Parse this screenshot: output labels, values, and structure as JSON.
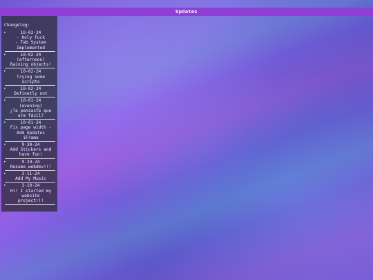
{
  "header": {
    "title": "Updates"
  },
  "sidebar": {
    "label": "Changelog:",
    "entries": [
      {
        "date": "10-03-24",
        "text": "- Holy Fuck\n- Tab System\nImplemented"
      },
      {
        "date": "10-02-24",
        "text": "(afternoon)\nRaining objects!"
      },
      {
        "date": "10-02-24",
        "text": "Trying some\nscripts"
      },
      {
        "date": "10-02-24",
        "text": "Definetly not"
      },
      {
        "date": "10-01-24",
        "text": "(evening)\n¿Te pensaste que\nera fácil?"
      },
      {
        "date": "10-01-24",
        "text": "Fix page width -\nAdd Updates\niFrame"
      },
      {
        "date": "9-30-24",
        "text": "Add Stickers and\nhave fun!"
      },
      {
        "date": "9-29-24",
        "text": "Resume webdev!!!"
      },
      {
        "date": "3-11-24",
        "text": "Add My Music"
      },
      {
        "date": "3-10-24",
        "text": "Hi! I started my\nwebsite\nproject!!!"
      }
    ]
  }
}
